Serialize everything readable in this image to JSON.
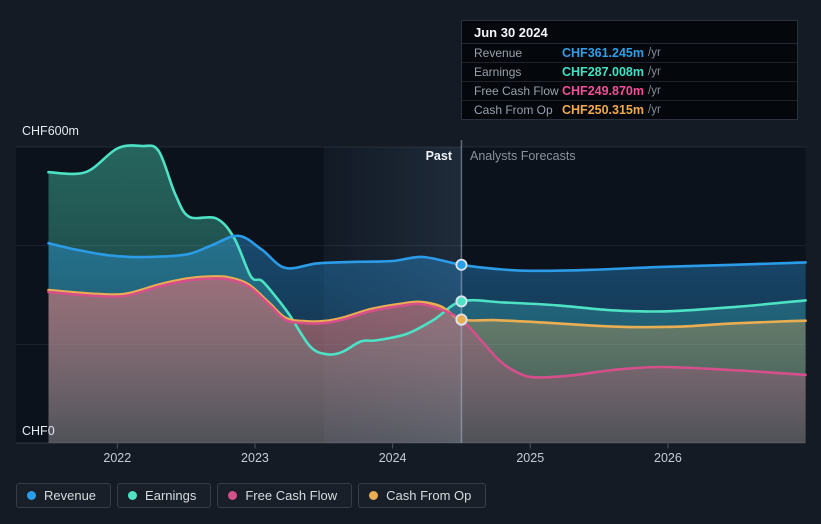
{
  "tooltip": {
    "date": "Jun 30 2024",
    "rows": [
      {
        "label": "Revenue",
        "value": "CHF361.245m",
        "suffix": "/yr",
        "color": "#2f9fe8"
      },
      {
        "label": "Earnings",
        "value": "CHF287.008m",
        "suffix": "/yr",
        "color": "#41e2c2"
      },
      {
        "label": "Free Cash Flow",
        "value": "CHF249.870m",
        "suffix": "/yr",
        "color": "#ef5097"
      },
      {
        "label": "Cash From Op",
        "value": "CHF250.315m",
        "suffix": "/yr",
        "color": "#f0a94c"
      }
    ]
  },
  "axis": {
    "y_top_label": "CHF600m",
    "y_bottom_label": "CHF0"
  },
  "sections": {
    "past": "Past",
    "forecast": "Analysts Forecasts"
  },
  "legend": [
    {
      "label": "Revenue",
      "color": "#2b9ce8"
    },
    {
      "label": "Earnings",
      "color": "#4ee2c4"
    },
    {
      "label": "Free Cash Flow",
      "color": "#d54f8a"
    },
    {
      "label": "Cash From Op",
      "color": "#eaae52"
    }
  ],
  "chart_data": {
    "type": "area",
    "title": "Past performance and analyst forecasts",
    "unit": "CHF millions per year",
    "currency": "CHF",
    "x_domain": [
      2021.5,
      2027.0
    ],
    "y_domain": [
      0,
      600
    ],
    "y_gridline_values": [
      600,
      400,
      200,
      0
    ],
    "x_ticks": [
      "2022",
      "2023",
      "2024",
      "2025",
      "2026"
    ],
    "x_tick_values": [
      2022,
      2023,
      2024,
      2025,
      2026
    ],
    "divider_x": 2024.5,
    "divider_date": "Jun 30 2024",
    "highlight_band": [
      2023.5,
      2024.5
    ],
    "legend_position": "bottom-left",
    "grid": true,
    "marker_values": {
      "Revenue": 361.245,
      "Earnings": 287.008,
      "Free Cash Flow": 249.87,
      "Cash From Op": 250.315
    },
    "series": [
      {
        "name": "Earnings",
        "color": "#4ee2c4",
        "points": [
          [
            2021.5,
            549
          ],
          [
            2021.77,
            549
          ],
          [
            2022.0,
            597
          ],
          [
            2022.18,
            602
          ],
          [
            2022.3,
            592
          ],
          [
            2022.42,
            505
          ],
          [
            2022.52,
            459
          ],
          [
            2022.72,
            455
          ],
          [
            2022.85,
            415
          ],
          [
            2022.97,
            338
          ],
          [
            2023.05,
            329
          ],
          [
            2023.15,
            297
          ],
          [
            2023.25,
            260
          ],
          [
            2023.4,
            196
          ],
          [
            2023.52,
            180
          ],
          [
            2023.63,
            184
          ],
          [
            2023.77,
            206
          ],
          [
            2023.88,
            208
          ],
          [
            2024.1,
            221
          ],
          [
            2024.3,
            250
          ],
          [
            2024.5,
            287.008
          ],
          [
            2024.8,
            285
          ],
          [
            2025.2,
            279
          ],
          [
            2025.6,
            269
          ],
          [
            2026.0,
            267
          ],
          [
            2026.5,
            276
          ],
          [
            2027.0,
            289
          ]
        ]
      },
      {
        "name": "Revenue",
        "color": "#2b9ce8",
        "points": [
          [
            2021.5,
            405
          ],
          [
            2021.7,
            392
          ],
          [
            2021.95,
            380
          ],
          [
            2022.2,
            377
          ],
          [
            2022.5,
            382
          ],
          [
            2022.68,
            400
          ],
          [
            2022.88,
            420
          ],
          [
            2023.05,
            392
          ],
          [
            2023.22,
            355
          ],
          [
            2023.45,
            364
          ],
          [
            2023.7,
            367
          ],
          [
            2024.0,
            369
          ],
          [
            2024.22,
            377
          ],
          [
            2024.5,
            361.245
          ],
          [
            2024.75,
            353
          ],
          [
            2025.0,
            349
          ],
          [
            2025.45,
            351
          ],
          [
            2025.95,
            357
          ],
          [
            2026.45,
            361
          ],
          [
            2026.9,
            365
          ],
          [
            2027.0,
            366
          ]
        ]
      },
      {
        "name": "Cash From Op",
        "color": "#eaae52",
        "points": [
          [
            2021.5,
            310
          ],
          [
            2021.8,
            303
          ],
          [
            2022.05,
            302
          ],
          [
            2022.3,
            321
          ],
          [
            2022.5,
            333
          ],
          [
            2022.65,
            337
          ],
          [
            2022.8,
            336
          ],
          [
            2022.95,
            322
          ],
          [
            2023.1,
            285
          ],
          [
            2023.22,
            254
          ],
          [
            2023.35,
            247
          ],
          [
            2023.5,
            247
          ],
          [
            2023.65,
            255
          ],
          [
            2023.85,
            272
          ],
          [
            2024.08,
            283
          ],
          [
            2024.2,
            286
          ],
          [
            2024.35,
            277
          ],
          [
            2024.5,
            250.315
          ],
          [
            2024.75,
            249
          ],
          [
            2025.1,
            244
          ],
          [
            2025.45,
            238
          ],
          [
            2025.75,
            235
          ],
          [
            2026.1,
            236
          ],
          [
            2026.45,
            242
          ],
          [
            2026.9,
            247
          ],
          [
            2027.0,
            248
          ]
        ]
      },
      {
        "name": "Free Cash Flow",
        "color": "#d54f8a",
        "points": [
          [
            2021.5,
            306
          ],
          [
            2021.8,
            299
          ],
          [
            2022.05,
            298
          ],
          [
            2022.3,
            317
          ],
          [
            2022.5,
            329
          ],
          [
            2022.65,
            333
          ],
          [
            2022.8,
            332
          ],
          [
            2022.95,
            318
          ],
          [
            2023.1,
            281
          ],
          [
            2023.22,
            250
          ],
          [
            2023.35,
            243
          ],
          [
            2023.5,
            243
          ],
          [
            2023.65,
            251
          ],
          [
            2023.85,
            268
          ],
          [
            2024.08,
            279
          ],
          [
            2024.2,
            282
          ],
          [
            2024.35,
            271
          ],
          [
            2024.5,
            249.87
          ],
          [
            2024.62,
            215
          ],
          [
            2024.78,
            166
          ],
          [
            2024.92,
            141
          ],
          [
            2025.05,
            133
          ],
          [
            2025.3,
            137
          ],
          [
            2025.6,
            148
          ],
          [
            2025.95,
            154
          ],
          [
            2026.45,
            148
          ],
          [
            2026.9,
            140
          ],
          [
            2027.0,
            138
          ]
        ]
      }
    ]
  }
}
